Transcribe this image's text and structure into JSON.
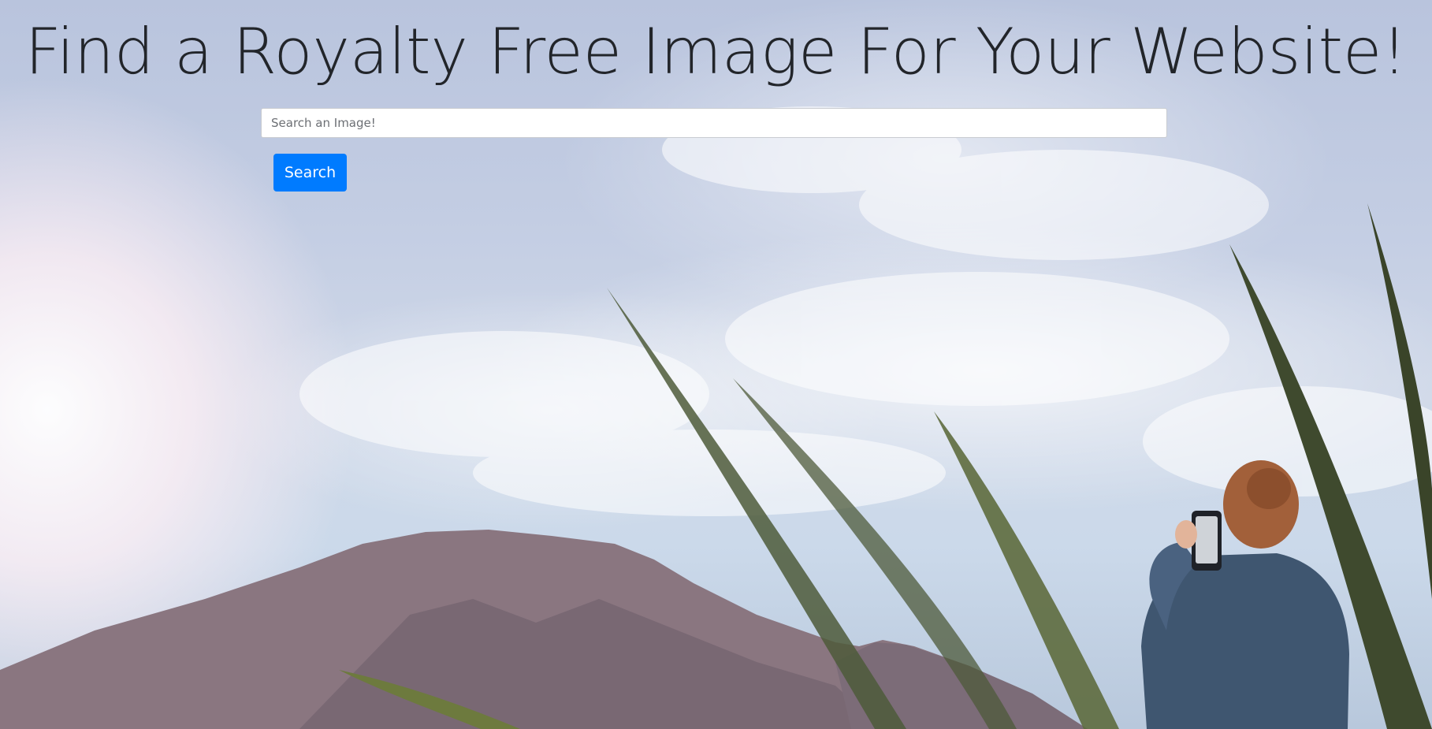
{
  "page": {
    "title": "Find a Royalty Free Image For Your Website!"
  },
  "search": {
    "placeholder": "Search an Image!",
    "value": "",
    "button_label": "Search"
  },
  "colors": {
    "button": "#007bff",
    "title_text": "#22252a"
  }
}
